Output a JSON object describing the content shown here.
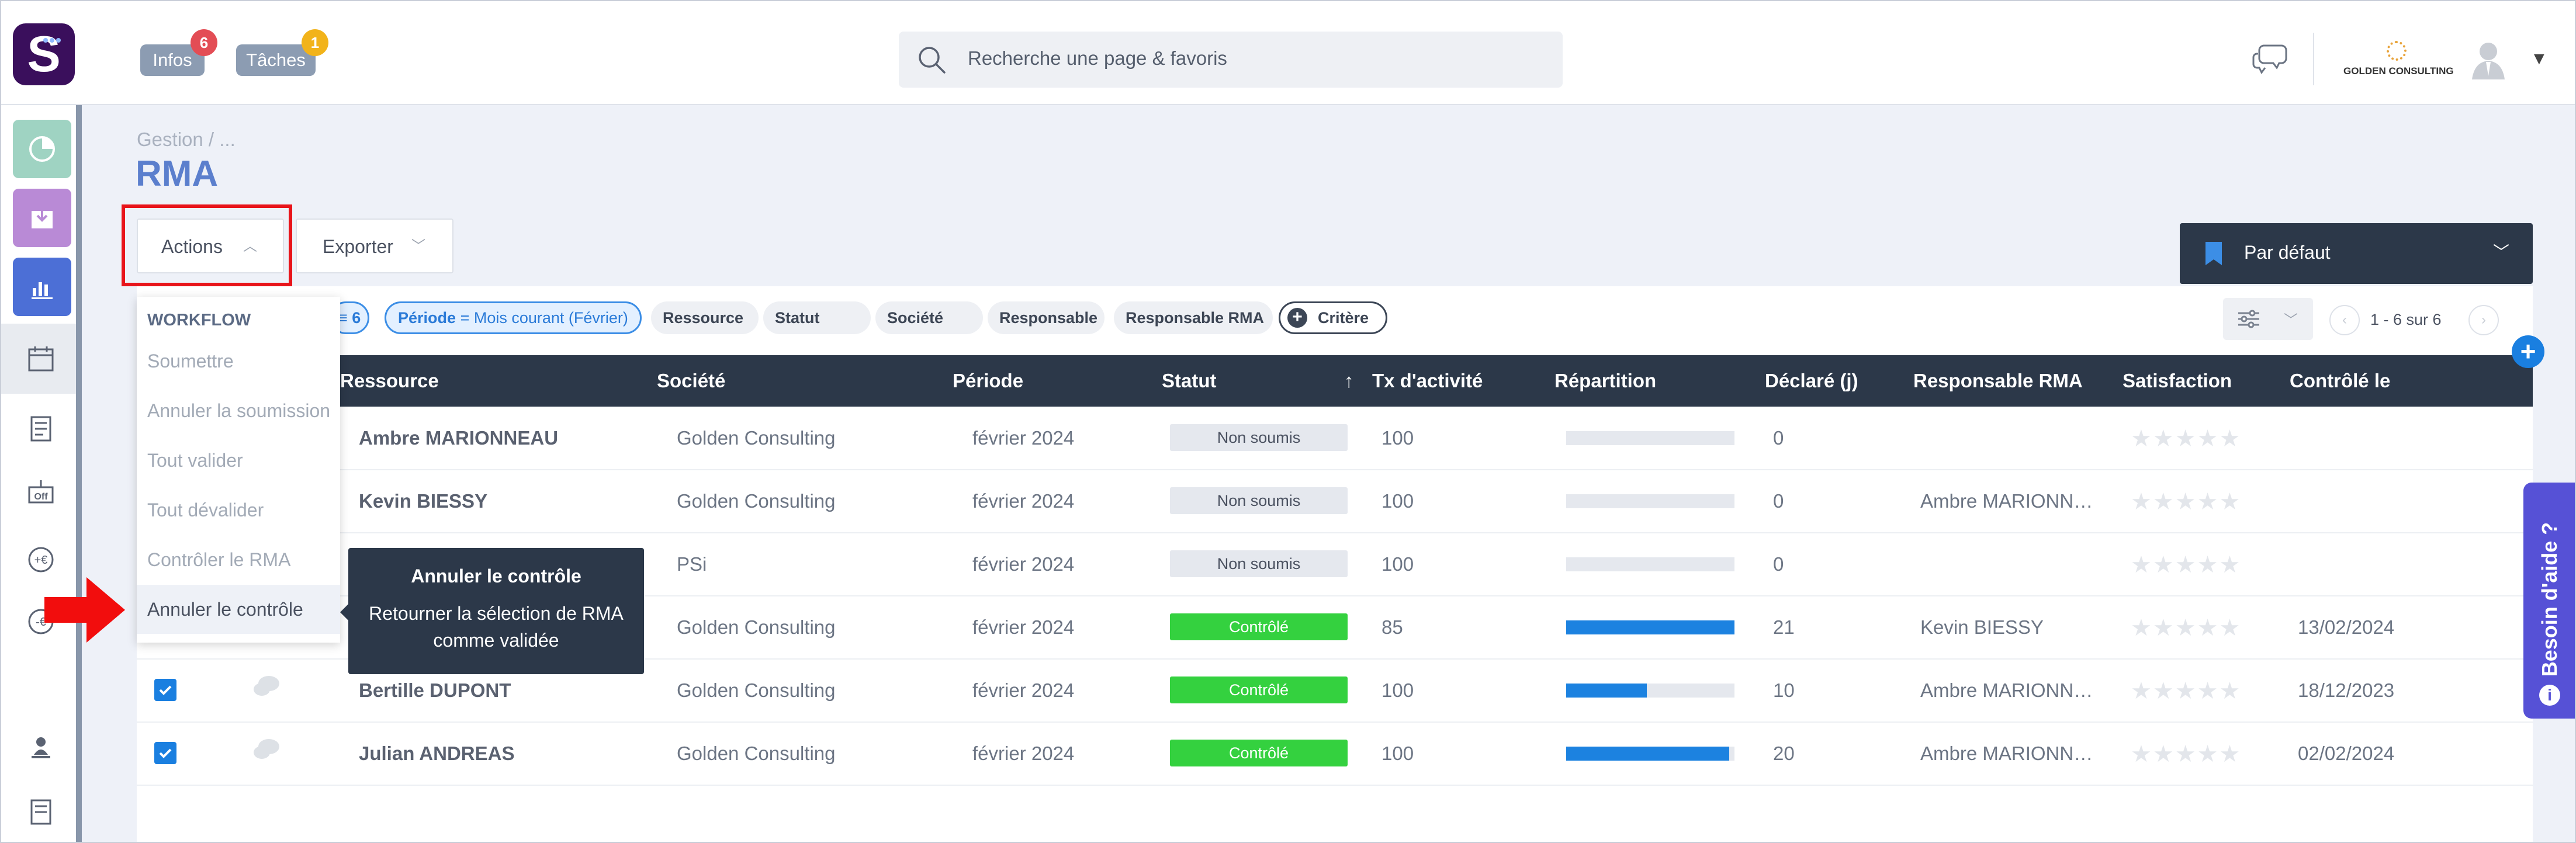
{
  "header": {
    "logo_letter": "S",
    "infos_label": "Infos",
    "infos_count": "6",
    "taches_label": "Tâches",
    "taches_count": "1",
    "search_placeholder": "Recherche une page & favoris",
    "company_name": "GOLDEN CONSULTING",
    "icons": [
      "search-icon",
      "chat-icon",
      "user-avatar-icon",
      "caret-down-icon"
    ]
  },
  "sidebar": {
    "icons": [
      "dashboard-icon",
      "inbox-download-icon",
      "bar-chart-icon",
      "calendar-icon",
      "document-icon",
      "off-icon",
      "euro-plus-icon",
      "euro-minus-icon",
      "person-icon",
      "report-icon"
    ]
  },
  "page": {
    "breadcrumb": "Gestion  /  ...",
    "title": "RMA",
    "actions_label": "Actions",
    "exporter_label": "Exporter",
    "view_label": "Par défaut"
  },
  "filters": {
    "count": "6",
    "periode_key": "Période",
    "periode_value": "= Mois courant (Février)",
    "chips": [
      "Ressource",
      "Statut",
      "Société",
      "Responsable",
      "Responsable RMA"
    ],
    "critere_label": "Critère",
    "pagination": "1 - 6 sur 6"
  },
  "table": {
    "columns": [
      "Ressource",
      "Société",
      "Période",
      "Statut",
      "Tx d'activité",
      "Répartition",
      "Déclaré (j)",
      "Responsable RMA",
      "Satisfaction",
      "Contrôlé le"
    ],
    "sort_indicator": "↑",
    "rows": [
      {
        "ressource": "Ambre MARIONNEAU",
        "societe": "Golden Consulting",
        "periode": "février 2024",
        "statut": "Non soumis",
        "tx": "100",
        "repartition": 0,
        "declare": "0",
        "responsable": "",
        "satisfaction": "★★★★★",
        "controle": "",
        "checked": false
      },
      {
        "ressource": "Kevin BIESSY",
        "societe": "Golden Consulting",
        "periode": "février 2024",
        "statut": "Non soumis",
        "tx": "100",
        "repartition": 0,
        "declare": "0",
        "responsable": "Ambre MARIONN…",
        "satisfaction": "★★★★★",
        "controle": "",
        "checked": false
      },
      {
        "ressource": "",
        "societe": "PSi",
        "periode": "février 2024",
        "statut": "Non soumis",
        "tx": "100",
        "repartition": 0,
        "declare": "0",
        "responsable": "",
        "satisfaction": "★★★★★",
        "controle": "",
        "checked": false
      },
      {
        "ressource": "",
        "societe": "Golden Consulting",
        "periode": "février 2024",
        "statut": "Contrôlé",
        "tx": "85",
        "repartition": 1.0,
        "declare": "21",
        "responsable": "Kevin BIESSY",
        "satisfaction": "★★★★★",
        "controle": "13/02/2024",
        "checked": false
      },
      {
        "ressource": "Bertille DUPONT",
        "societe": "Golden Consulting",
        "periode": "février 2024",
        "statut": "Contrôlé",
        "tx": "100",
        "repartition": 0.48,
        "declare": "10",
        "responsable": "Ambre MARIONN…",
        "satisfaction": "★★★★★",
        "controle": "18/12/2023",
        "checked": true
      },
      {
        "ressource": "Julian ANDREAS",
        "societe": "Golden Consulting",
        "periode": "février 2024",
        "statut": "Contrôlé",
        "tx": "100",
        "repartition": 0.97,
        "declare": "20",
        "responsable": "Ambre MARIONN…",
        "satisfaction": "★★★★★",
        "controle": "02/02/2024",
        "checked": true
      }
    ]
  },
  "dropdown": {
    "heading": "WORKFLOW",
    "items": [
      "Soumettre",
      "Annuler la soumission",
      "Tout valider",
      "Tout dévalider",
      "Contrôler le RMA",
      "Annuler le contrôle"
    ],
    "active_index": 5
  },
  "tooltip": {
    "title": "Annuler le contrôle",
    "body": "Retourner la sélection de RMA comme validée"
  },
  "help": {
    "label": "Besoin d'aide ?",
    "icon": "i"
  },
  "colors": {
    "accent": "#5b7fcd",
    "dark": "#2c3849",
    "controle_green": "#34d13f",
    "bar_blue": "#1c82e0",
    "annotation_red": "#e8141a",
    "help_purple": "#5651d6"
  }
}
